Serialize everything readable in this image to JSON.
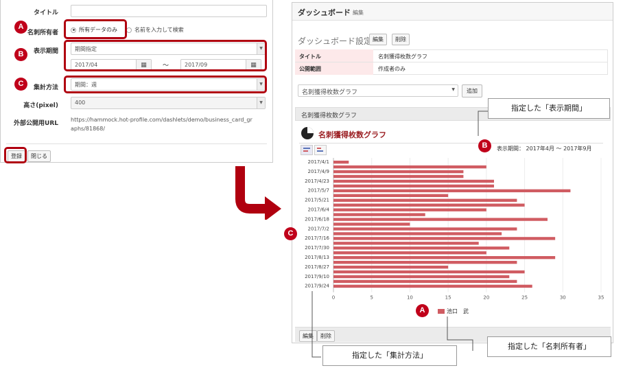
{
  "form": {
    "rows": [
      {
        "label": "タイトル",
        "value": ""
      },
      {
        "label": "名刺所有者"
      },
      {
        "label": "表示期間"
      },
      {
        "label": "集計方法"
      },
      {
        "label": "高さ(pixel)"
      },
      {
        "label": "外部公開用URL"
      }
    ],
    "owner_options": [
      "所有データのみ",
      "名前を入力して検索"
    ],
    "period_select": "期間指定",
    "date_from": "2017/04",
    "date_to": "2017/09",
    "tilde": "～",
    "aggregation_select": "期間：週",
    "height_select": "400",
    "url_line1": "https://hammock.hot-profile.com/dashlets/demo/business_card_gr",
    "url_line2": "aphs/81868/",
    "register_label": "登録",
    "close_label": "閉じる"
  },
  "badges": {
    "a": "A",
    "b": "B",
    "c": "C"
  },
  "dashboard": {
    "title": "ダッシュボード",
    "edit_link": "編集",
    "settings_title": "ダッシュボード設定",
    "edit_btn": "編集",
    "delete_btn": "削除",
    "table": [
      {
        "key": "タイトル",
        "val": "名刺獲得枚数グラフ"
      },
      {
        "key": "公開範囲",
        "val": "作成者のみ"
      }
    ],
    "dashlet_select": "名刺獲得枚数グラフ",
    "add_btn": "追加",
    "panel_title": "名刺獲得枚数グラフ",
    "footer_edit": "編集",
    "footer_delete": "削除"
  },
  "chart_data": {
    "type": "bar",
    "orientation": "horizontal",
    "title": "名刺獲得枚数グラフ",
    "period_label": "表示期間： 2017年4月 ～ 2017年9月",
    "categories": [
      "2017/4/1",
      "2017/4/9",
      "2017/4/23",
      "2017/5/7",
      "2017/5/21",
      "2017/6/4",
      "2017/6/18",
      "2017/7/2",
      "2017/7/16",
      "2017/7/30",
      "2017/8/13",
      "2017/8/27",
      "2017/9/10",
      "2017/9/24"
    ],
    "bars": [
      {
        "label": "2017/4/1",
        "value": 2
      },
      {
        "value": 20
      },
      {
        "label": "2017/4/9",
        "value": 17
      },
      {
        "value": 17
      },
      {
        "label": "2017/4/23",
        "value": 21
      },
      {
        "value": 21
      },
      {
        "label": "2017/5/7",
        "value": 31
      },
      {
        "value": 15
      },
      {
        "label": "2017/5/21",
        "value": 24
      },
      {
        "value": 25
      },
      {
        "label": "2017/6/4",
        "value": 20
      },
      {
        "value": 12
      },
      {
        "label": "2017/6/18",
        "value": 28
      },
      {
        "value": 10
      },
      {
        "label": "2017/7/2",
        "value": 24
      },
      {
        "value": 22
      },
      {
        "label": "2017/7/16",
        "value": 29
      },
      {
        "value": 19
      },
      {
        "label": "2017/7/30",
        "value": 23
      },
      {
        "value": 20
      },
      {
        "label": "2017/8/13",
        "value": 29
      },
      {
        "value": 24
      },
      {
        "label": "2017/8/27",
        "value": 15
      },
      {
        "value": 25
      },
      {
        "label": "2017/9/10",
        "value": 23
      },
      {
        "value": 24
      },
      {
        "label": "2017/9/24",
        "value": 26
      }
    ],
    "xticks": [
      0,
      5,
      10,
      15,
      20,
      25,
      30,
      35
    ],
    "xlim": [
      0,
      35
    ],
    "legend": "池口　武",
    "color": "#d05c62",
    "grid": true
  },
  "callouts": {
    "period": "指定した「表示期間」",
    "owner": "指定した「名刺所有者」",
    "aggregation": "指定した「集計方法」"
  },
  "colors": {
    "accent": "#b0000f",
    "bar": "#d05c62",
    "title": "#9b1e22"
  }
}
